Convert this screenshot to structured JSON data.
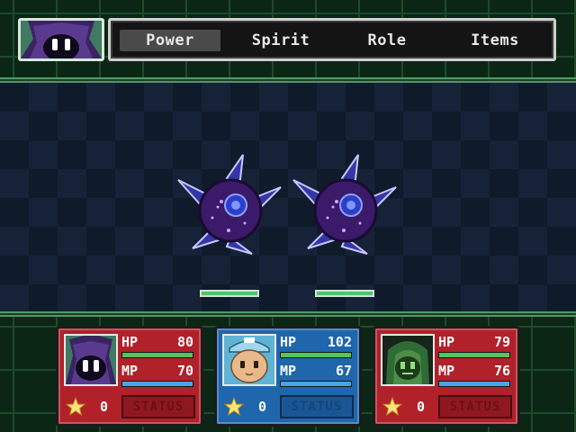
{
  "menu": {
    "items": [
      "Power",
      "Spirit",
      "Role",
      "Items"
    ],
    "selected": "Power"
  },
  "active_character": {
    "portrait_icon": "dark-purple-hooded-character-icon"
  },
  "enemies": [
    {
      "icon": "spiked-purple-orb-enemy-icon",
      "hp_fraction": 1.0
    },
    {
      "icon": "spiked-purple-orb-enemy-icon",
      "hp_fraction": 1.0
    }
  ],
  "party": [
    {
      "portrait_icon": "dark-purple-hooded-character-icon",
      "card_color": "#b0212a",
      "hp_label": "HP",
      "hp": "80",
      "mp_label": "MP",
      "mp": "70",
      "stars": "0",
      "status_label": "STATUS",
      "hp_fraction": 1.0,
      "mp_fraction": 1.0
    },
    {
      "portrait_icon": "capped-beige-character-icon",
      "card_color": "#1f66ad",
      "hp_label": "HP",
      "hp": "102",
      "mp_label": "MP",
      "mp": "67",
      "stars": "0",
      "status_label": "STATUS",
      "hp_fraction": 1.0,
      "mp_fraction": 1.0
    },
    {
      "portrait_icon": "green-hooded-character-icon",
      "card_color": "#b0212a",
      "hp_label": "HP",
      "hp": "79",
      "mp_label": "MP",
      "mp": "76",
      "stars": "0",
      "status_label": "STATUS",
      "hp_fraction": 1.0,
      "mp_fraction": 1.0
    }
  ],
  "colors": {
    "hp_bar": "#56c45d",
    "mp_bar": "#49a3e6",
    "enemy_hp_bar": "#52c46a",
    "menu_highlight": "#4a4a4a"
  }
}
